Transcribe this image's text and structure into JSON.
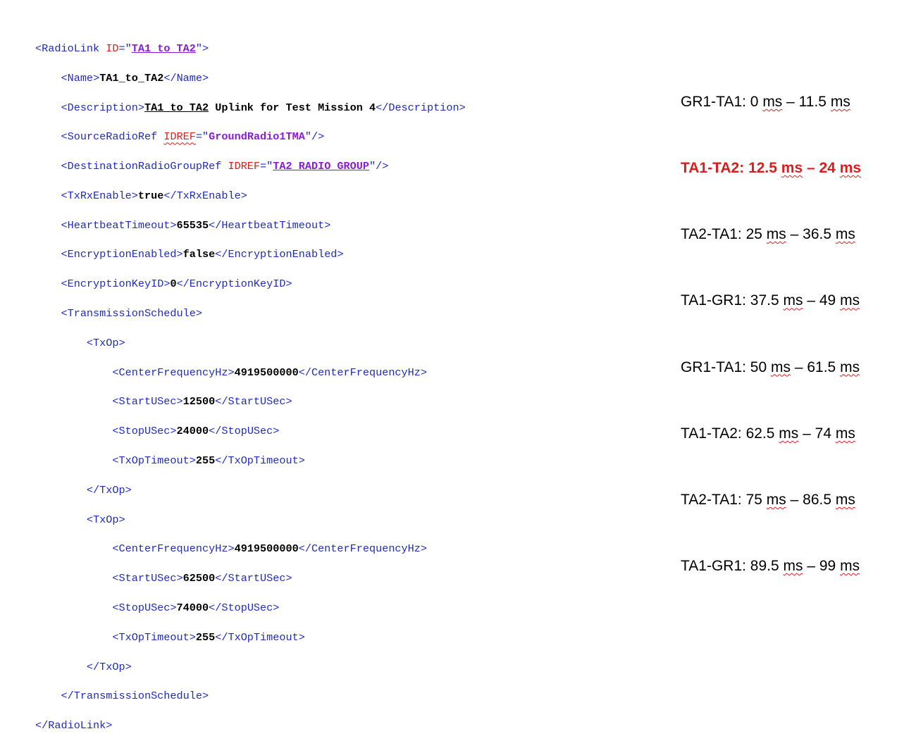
{
  "xml": {
    "root_open_tag": "RadioLink",
    "root_id_attr": "ID",
    "root_id_value": "TA1_to_TA2",
    "name_tag": "Name",
    "name_value": "TA1_to_TA2",
    "description_tag": "Description",
    "description_value_ul": "TA1_to_TA2",
    "description_value_rest": " Uplink for Test Mission 4",
    "source_tag": "SourceRadioRef",
    "source_attr": "IDREF",
    "source_value": "GroundRadio1TMA",
    "dest_tag": "DestinationRadioGroupRef",
    "dest_attr": "IDREF",
    "dest_value": "TA2_RADIO_GROUP",
    "txrx_tag": "TxRxEnable",
    "txrx_value": "true",
    "heartbeat_tag": "HeartbeatTimeout",
    "heartbeat_value": "65535",
    "enc_enabled_tag": "EncryptionEnabled",
    "enc_enabled_value": "false",
    "enc_key_tag": "EncryptionKeyID",
    "enc_key_value": "0",
    "schedule_tag": "TransmissionSchedule",
    "txop_tag": "TxOp",
    "freq_tag": "CenterFrequencyHz",
    "start_tag": "StartUSec",
    "stop_tag": "StopUSec",
    "timeout_tag": "TxOpTimeout",
    "txops": [
      {
        "freq": "4919500000",
        "start": "12500",
        "stop": "24000",
        "timeout": "255"
      },
      {
        "freq": "4919500000",
        "start": "62500",
        "stop": "74000",
        "timeout": "255"
      }
    ]
  },
  "schedule": [
    {
      "link": "GR1-TA1: ",
      "from": "0 ",
      "to": "11.5 ",
      "unit": "ms",
      "highlight": false
    },
    {
      "link": "TA1-TA2: ",
      "from": "12.5 ",
      "to": "24 ",
      "unit": "ms",
      "highlight": true
    },
    {
      "link": "TA2-TA1: ",
      "from": "25 ",
      "to": "36.5 ",
      "unit": "ms",
      "highlight": false
    },
    {
      "link": "TA1-GR1: ",
      "from": "37.5 ",
      "to": "49 ",
      "unit": "ms",
      "highlight": false
    },
    {
      "link": "GR1-TA1: ",
      "from": "50 ",
      "to": "61.5 ",
      "unit": "ms",
      "highlight": false
    },
    {
      "link": "TA1-TA2: ",
      "from": "62.5 ",
      "to": "74 ",
      "unit": "ms",
      "highlight": false
    },
    {
      "link": "TA2-TA1: ",
      "from": "75 ",
      "to": "86.5 ",
      "unit": "ms",
      "highlight": false
    },
    {
      "link": "TA1-GR1: ",
      "from": "89.5 ",
      "to": "99 ",
      "unit": "ms",
      "highlight": false
    }
  ],
  "colors": {
    "tag": "#1f2bbf",
    "attr_name": "#e01b1b",
    "attr_value": "#8a1bd6",
    "highlight": "#e01b1b"
  }
}
